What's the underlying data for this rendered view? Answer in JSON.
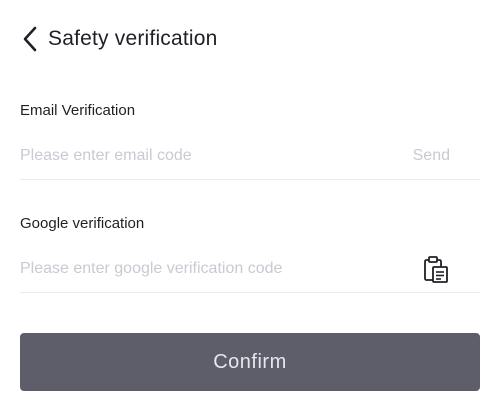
{
  "header": {
    "title": "Safety verification",
    "back_icon": "chevron-left-icon"
  },
  "email_verification": {
    "label": "Email Verification",
    "placeholder": "Please enter email code",
    "value": "",
    "send_label": "Send"
  },
  "google_verification": {
    "label": "Google verification",
    "placeholder": "Please enter google verification code",
    "value": "",
    "paste_icon": "clipboard-paste-icon"
  },
  "confirm": {
    "label": "Confirm"
  },
  "colors": {
    "text_primary": "#1e2026",
    "placeholder": "#c7cbd1",
    "divider": "#eaecef",
    "button_bg": "#5e5e6a",
    "button_text": "#e6e7eb"
  }
}
